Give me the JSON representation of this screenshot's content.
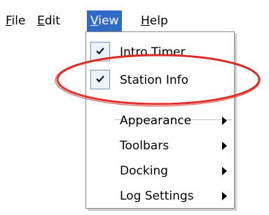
{
  "menubar": {
    "items": [
      {
        "mnemonic": "F",
        "rest": "ile"
      },
      {
        "mnemonic": "E",
        "rest": "dit"
      },
      {
        "mnemonic": "V",
        "rest": "iew"
      },
      {
        "mnemonic": "H",
        "rest": "elp"
      }
    ],
    "active_item": "View"
  },
  "view_menu": {
    "items": [
      {
        "label": "Intro Timer",
        "checked": true,
        "submenu": false
      },
      {
        "label": "Station Info",
        "checked": true,
        "submenu": false
      },
      {
        "label": "Appearance",
        "checked": false,
        "submenu": true
      },
      {
        "label": "Toolbars",
        "checked": false,
        "submenu": true
      },
      {
        "label": "Docking",
        "checked": false,
        "submenu": true
      },
      {
        "label": "Log Settings",
        "checked": false,
        "submenu": true
      }
    ],
    "check_icon": "checkmark-icon",
    "submenu_icon": "triangle-right-icon"
  },
  "annotation": {
    "shape": "ellipse",
    "color": "#e0302a",
    "target": "Station Info"
  },
  "colors": {
    "menubar_active_bg": "#316ac5",
    "menubar_active_text": "#ffffff",
    "menu_border": "#8a8a8a",
    "check_box_border": "#7a94c4",
    "check_box_bg": "#eef3fb"
  }
}
